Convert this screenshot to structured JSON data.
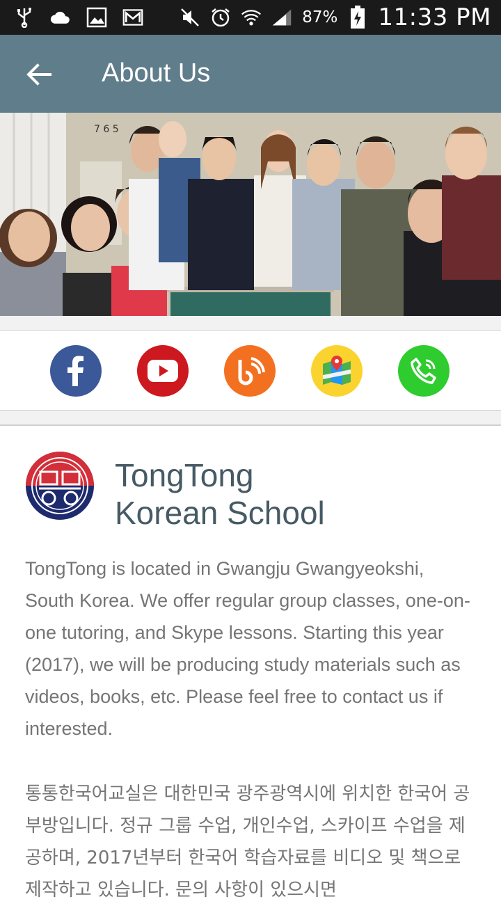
{
  "status_bar": {
    "battery_percent": "87%",
    "time": "11:33 PM",
    "icons": [
      "usb-icon",
      "cloud-icon",
      "image-icon",
      "gmail-icon",
      "mute-icon",
      "alarm-icon",
      "wifi-icon",
      "signal-icon",
      "battery-icon"
    ]
  },
  "app_bar": {
    "title": "About Us",
    "back_icon": "arrow-back-icon"
  },
  "hero": {
    "wall_numbers": "7 6 5"
  },
  "social": {
    "buttons": [
      {
        "name": "facebook",
        "color": "#3b5998"
      },
      {
        "name": "youtube",
        "color": "#cc181e"
      },
      {
        "name": "blog",
        "color": "#f37021"
      },
      {
        "name": "map",
        "color": "#fbd32f"
      },
      {
        "name": "phone",
        "color": "#2ecc2e"
      }
    ]
  },
  "school": {
    "name_line1": "TongTong",
    "name_line2": "Korean School",
    "description_en": "TongTong is located in Gwangju Gwangyeokshi, South Korea. We offer regular group classes, one-on-one tutoring, and Skype lessons. Starting this year (2017), we will be producing study materials such as videos, books, etc. Please feel free to contact us if interested.",
    "description_kr": "통통한국어교실은 대한민국 광주광역시에 위치한 한국어 공부방입니다. 정규 그룹 수업, 개인수업, 스카이프 수업을 제공하며, 2017년부터 한국어 학습자료를 비디오 및 책으로 제작하고 있습니다. 문의 사항이 있으시면"
  },
  "colors": {
    "status_bar": "#1a1a1a",
    "app_bar": "#607d8b",
    "title_text": "#455a64",
    "body_text": "#757575"
  }
}
